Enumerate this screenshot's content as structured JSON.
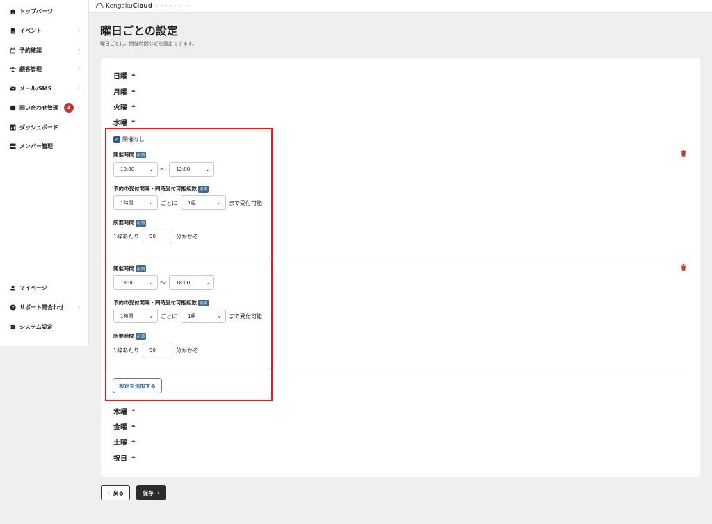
{
  "brand": {
    "name_prefix": "Kengaku",
    "name_suffix": "Cloud",
    "tagline": "• • • • • • • •"
  },
  "sidebar": {
    "items": [
      {
        "label": "トップページ",
        "icon": "home-icon"
      },
      {
        "label": "イベント",
        "icon": "document-icon",
        "chevron": "›"
      },
      {
        "label": "予約確認",
        "icon": "calendar-icon",
        "chevron": "›"
      },
      {
        "label": "顧客管理",
        "icon": "users-icon",
        "chevron": "›"
      },
      {
        "label": "メール/SMS",
        "icon": "mail-icon",
        "chevron": "›"
      },
      {
        "label": "問い合わせ管理",
        "icon": "chat-icon",
        "chevron": "›",
        "badge": "3"
      },
      {
        "label": "ダッシュボード",
        "icon": "chart-icon"
      },
      {
        "label": "メンバー管理",
        "icon": "grid-icon"
      }
    ],
    "bottom_items": [
      {
        "label": "マイページ",
        "icon": "user-icon"
      },
      {
        "label": "サポート問合わせ",
        "icon": "help-icon",
        "chevron": "›"
      },
      {
        "label": "システム設定",
        "icon": "gear-icon"
      }
    ]
  },
  "page": {
    "title": "曜日ごとの設定",
    "subtitle": "曜日ごとに、開催時間などを設定できます。"
  },
  "days_before": [
    "日曜",
    "月曜",
    "火曜",
    "水曜"
  ],
  "days_after": [
    "木曜",
    "金曜",
    "土曜",
    "祝日"
  ],
  "caret_up": "⏶",
  "caret_down": "⏷",
  "wednesday": {
    "closed_label": "開催なし",
    "required_badge": "必須",
    "hours_label": "開催時間",
    "interval_label": "予約の受付間隔・同時受付可能組数",
    "duration_label": "所要時間",
    "tilde": "〜",
    "every_text": "ごとに",
    "until_text": "まで受付可能",
    "per_slot_text": "1枠あたり",
    "minutes_text": "分かかる",
    "slots": [
      {
        "start": "10:00",
        "end": "12:00",
        "interval": "1時間",
        "groups": "1組",
        "duration": "90"
      },
      {
        "start": "13:00",
        "end": "18:00",
        "interval": "1時間",
        "groups": "1組",
        "duration": "90"
      }
    ],
    "add_button": "設定を追加する"
  },
  "footer": {
    "back_label": "← 戻る",
    "save_label": "保存 →"
  },
  "colors": {
    "accent": "#2c5d8a",
    "danger": "#c33a3a",
    "highlight": "#e11d1d"
  }
}
